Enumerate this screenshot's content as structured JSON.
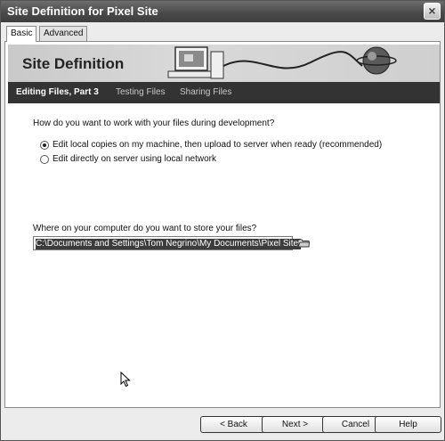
{
  "window": {
    "title": "Site Definition for Pixel Site",
    "close_label": "×"
  },
  "tabs": [
    {
      "label": "Basic",
      "active": true
    },
    {
      "label": "Advanced",
      "active": false
    }
  ],
  "banner": {
    "title": "Site Definition"
  },
  "steps": [
    {
      "label": "Editing Files, Part 3",
      "active": true
    },
    {
      "label": "Testing Files",
      "active": false
    },
    {
      "label": "Sharing Files",
      "active": false
    }
  ],
  "question1": "How do you want to work with your files during development?",
  "options": [
    {
      "label": "Edit local copies on my machine, then upload to server when ready (recommended)",
      "selected": true
    },
    {
      "label": "Edit directly on server using local network",
      "selected": false
    }
  ],
  "question2": "Where on your computer do you want to store your files?",
  "path_field": {
    "value": "C:\\Documents and Settings\\Tom Negrino\\My Documents\\Pixel Site\\"
  },
  "buttons": {
    "back": "< Back",
    "next": "Next >",
    "cancel": "Cancel",
    "help": "Help"
  }
}
